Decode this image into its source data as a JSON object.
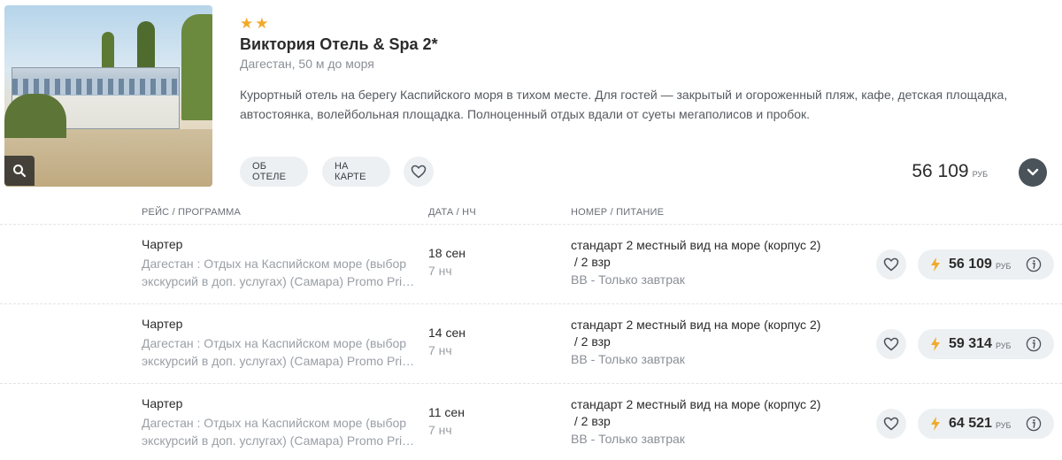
{
  "hotel": {
    "stars": 2,
    "name": "Виктория Отель & Spa 2*",
    "location": "Дагестан, 50 м до моря",
    "description": "Курортный отель на берегу Каспийского моря в тихом месте. Для гостей — закрытый и огороженный пляж, кафе, детская площадка, автостоянка, волейбольная площадка. Полноценный отдых вдали от суеты мегаполисов и пробок.",
    "about_label": "ОБ ОТЕЛЕ",
    "map_label": "НА КАРТЕ",
    "min_price": "56 109",
    "currency": "РУБ"
  },
  "table": {
    "headers": {
      "flight": "РЕЙС / ПРОГРАММА",
      "date": "ДАТА / НЧ",
      "room": "НОМЕР / ПИТАНИЕ"
    },
    "rows": [
      {
        "type": "Чартер",
        "program_line1": "Дагестан : Отдых на Каспийском море (выбор",
        "program_line2": "экскурсий в доп. услугах) (Самара) Promo Pri…",
        "date": "18 сен",
        "nights": "7 нч",
        "room_line1": "стандарт 2 местный вид на море (корпус 2)",
        "room_line2": " / 2 взр",
        "meal": "BB - Только завтрак",
        "price": "56 109",
        "currency": "РУБ"
      },
      {
        "type": "Чартер",
        "program_line1": "Дагестан : Отдых на Каспийском море (выбор",
        "program_line2": "экскурсий в доп. услугах) (Самара) Promo Pri…",
        "date": "14 сен",
        "nights": "7 нч",
        "room_line1": "стандарт 2 местный вид на море (корпус 2)",
        "room_line2": " / 2 взр",
        "meal": "BB - Только завтрак",
        "price": "59 314",
        "currency": "РУБ"
      },
      {
        "type": "Чартер",
        "program_line1": "Дагестан : Отдых на Каспийском море (выбор",
        "program_line2": "экскурсий в доп. услугах) (Самара) Promo Pri…",
        "date": "11 сен",
        "nights": "7 нч",
        "room_line1": "стандарт 2 местный вид на море (корпус 2)",
        "room_line2": " / 2 взр",
        "meal": "BB - Только завтрак",
        "price": "64 521",
        "currency": "РУБ"
      }
    ]
  },
  "icons": {
    "search": "search-icon",
    "heart": "heart-icon",
    "chevron": "chevron-down-icon",
    "bolt": "lightning-icon",
    "info": "info-icon"
  },
  "colors": {
    "star": "#f0a92a",
    "bolt": "#f0a92a",
    "expand_button": "#4a525a",
    "pill_bg": "#edf0f2"
  }
}
